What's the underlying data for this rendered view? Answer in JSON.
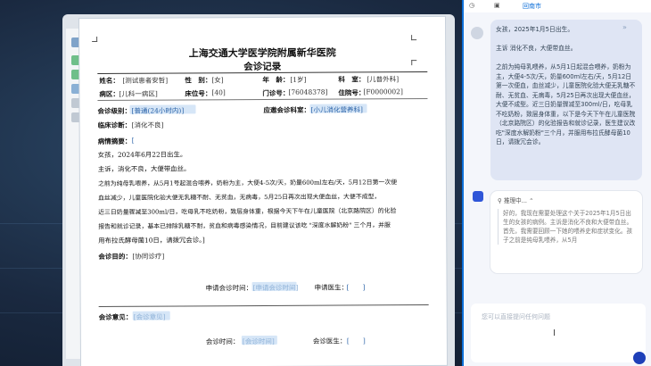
{
  "document": {
    "hospital_name": "上海交通大学医学院附属新华医院",
    "title": "会诊记录",
    "fields": {
      "name_label": "姓名：",
      "name_value": "[测试患者安哲]",
      "sex_label": "性　别：",
      "sex_value": "[女]",
      "age_label": "年　龄：",
      "age_value": "[1岁]",
      "dept_label": "科　室：",
      "dept_value": "[儿普外科]",
      "ward_label": "病区：",
      "ward_value": "[儿科一病区]",
      "bed_label": "床位号：",
      "bed_value": "[40]",
      "clinic_label": "门诊号：",
      "clinic_value": "[76048378]",
      "inpatient_label": "住院号：",
      "inpatient_value": "[F0000002]"
    },
    "consult_level_label": "会诊级别：",
    "consult_level_value": "[普通(24小时内)]",
    "consult_dept_label": "应邀会诊科室：",
    "consult_dept_value": "[小儿消化营养科]",
    "diagnosis_label": "临床诊断：",
    "diagnosis_value": "[消化不良]",
    "summary_label": "病情摘要：",
    "summary_bracket": "[",
    "summary_lines": [
      "女孩，2024年6月22日出生。",
      "主诉，消化不良，大便带血丝。",
      "之前为纯母乳喂养，从5月1号起混合喂养，奶粉为主，大便4-5次/天，奶量600ml左右/天，5月12日第一次便",
      "血丝减少，儿童医院化验大便无乳糖不耐、无贫血，无病毒，5月25日再次出现大便血丝，大便不成型，",
      "近三日奶量骤减至300ml/日，吃母乳不吃奶粉，致层身体重，根据今天下午在儿童医院（北京路院区）的化验",
      "报告和就诊记录，基本已排除乳糖不耐，贫血和病毒感染情况，目前建议该吃 \"深度水解奶粉\" 三个月，并服",
      "用布拉氏酵母菌10日，请拨冗会诊。]"
    ],
    "purpose_label": "会诊目的：",
    "purpose_value": "[协同诊疗]",
    "request_time_label": "申请会诊时间：",
    "request_time_value": "[申请会诊时间]",
    "request_doctor_label": "申请医生：",
    "request_doctor_value": "[　　]",
    "opinion_label": "会诊意见：",
    "opinion_value": "[会诊意见]",
    "consult_time_label": "会诊时间：",
    "consult_time_value": "[会诊时间]",
    "consult_doctor_label": "会诊医生：",
    "consult_doctor_value": "[　　]"
  },
  "panel": {
    "tabs": [
      "回南市"
    ],
    "user_message": "女孩，2025年1月5日出生。\n\n主诉 消化不良，大便带血丝。\n\n之前为纯母乳喂养，从5月1日起混合喂养，奶粉为主，大便4-5次/天，奶量600ml左右/天，5月12日第一次便血，血丝减少，儿童医院化验大便无乳糖不耐、无贫血、无病毒，5月25日再次出现大便血丝，大便不成型。近三日奶量骤减至300ml/日，吃母乳不吃奶粉，致层身体重，以下是今天下午在儿童医院（北京路院区）的化验报告和就诊记录，医生建议改吃\"深度水解奶粉\"三个月，并服用布拉氏酵母菌10日，请拨冗会诊。",
    "thinking_label": "推理中...",
    "ai_message": "好的，我现在需要处理这个关于2025年1月5日出生的女孩的病例。主诉是消化不良和大便带血丝。首先，我需要回顾一下她的喂养史和症状变化。孩子之前是纯母乳喂养，从5月",
    "input_placeholder": "您可以直接提问任何问题"
  },
  "colors": {
    "accent": "#0d6fd8",
    "field_chip": "#d6e6f7",
    "field_text": "#2b63a8"
  }
}
